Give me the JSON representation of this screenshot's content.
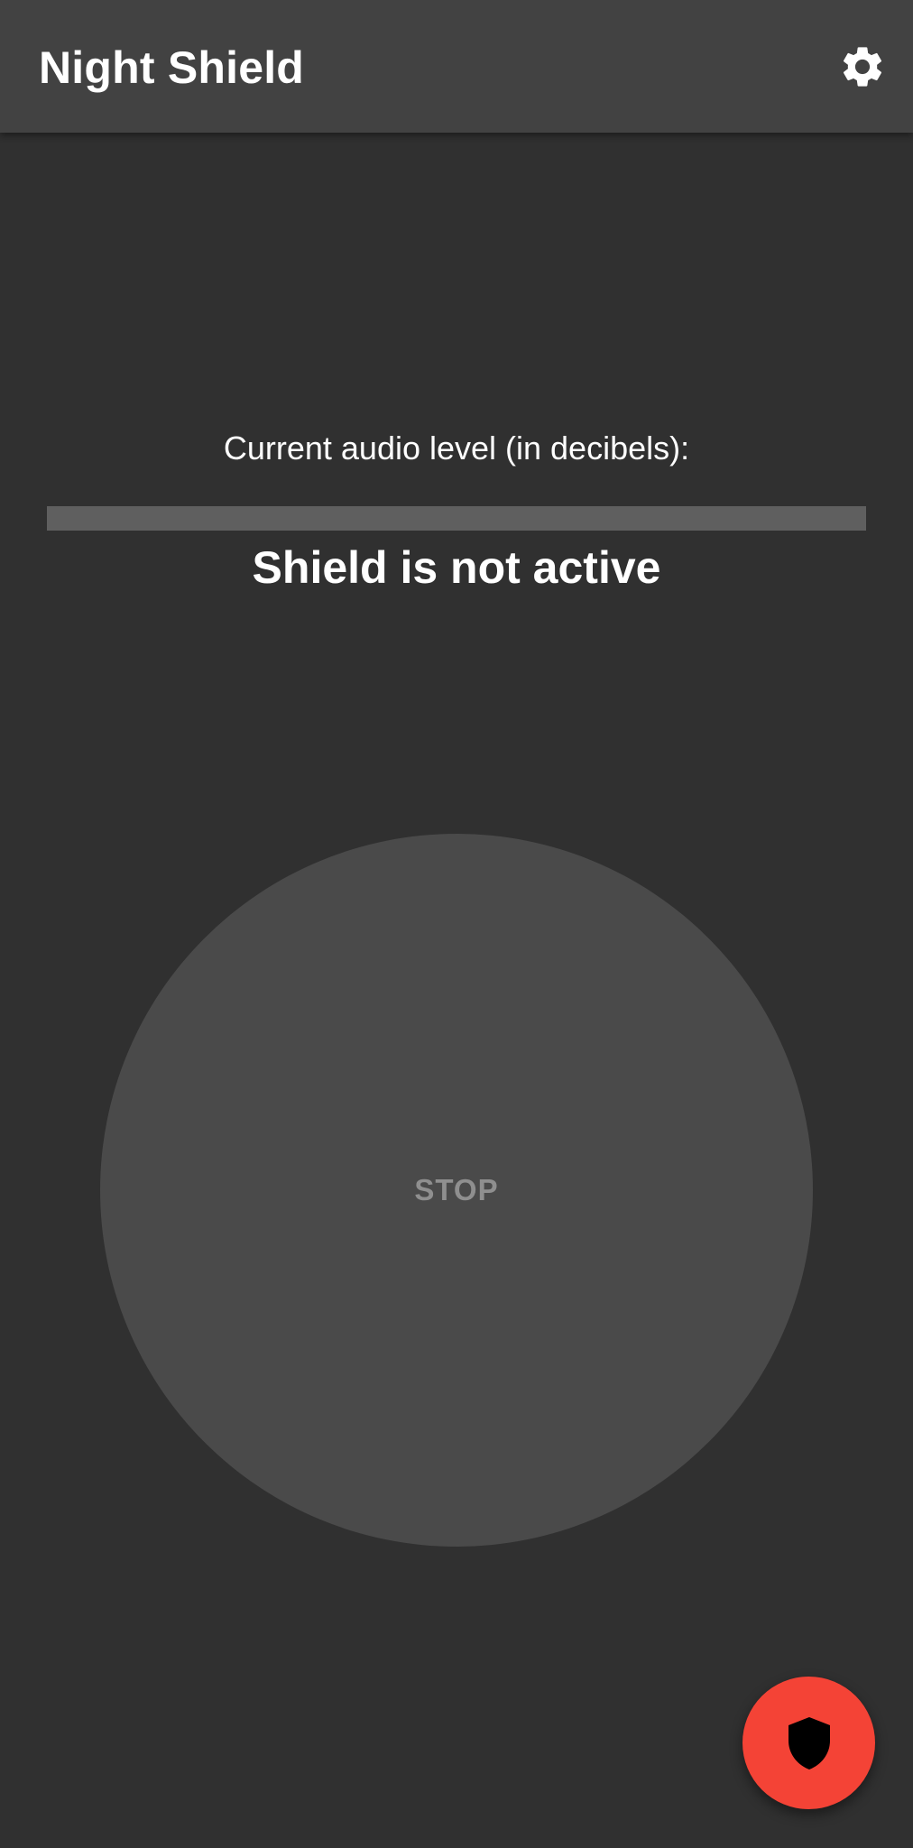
{
  "appbar": {
    "title": "Night Shield",
    "settings_icon": "gear-icon"
  },
  "audio": {
    "label": "Current audio level (in decibels):",
    "level_fraction": 0
  },
  "status": {
    "text": "Shield is not active"
  },
  "main_button": {
    "label": "STOP"
  },
  "fab": {
    "icon": "shield-icon",
    "color": "#f44336"
  },
  "colors": {
    "background": "#303030",
    "appbar": "#424242",
    "accent": "#f44336"
  }
}
